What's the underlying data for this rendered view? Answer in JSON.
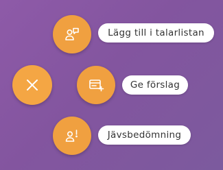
{
  "speed_dial": {
    "close_icon": "close-icon",
    "items": [
      {
        "id": "talarlista",
        "label": "Lägg till i talarlistan",
        "icon": "person-speech-icon"
      },
      {
        "id": "forslag",
        "label": "Ge förslag",
        "icon": "proposal-add-icon"
      },
      {
        "id": "javs",
        "label": "Jävsbedömning",
        "icon": "person-alert-icon"
      }
    ]
  },
  "colors": {
    "fab": "#f0a040",
    "background_start": "#8e5aa8",
    "background_end": "#7c5a9e",
    "label_text": "#333333",
    "label_bg": "#ffffff"
  }
}
